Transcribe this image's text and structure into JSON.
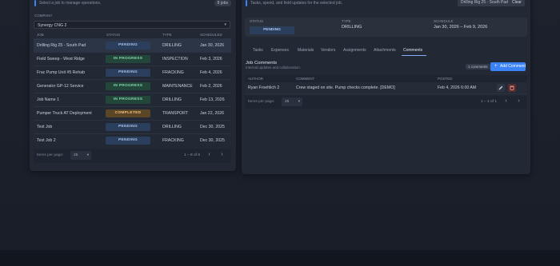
{
  "left_panel": {
    "subtitle": "Select a job to manage operations.",
    "jobs_badge": "8 jobs",
    "company_label": "COMPANY",
    "company_value": "Synergy CNG 2",
    "columns": [
      "JOB",
      "STATUS",
      "TYPE",
      "SCHEDULED"
    ],
    "rows": [
      {
        "job": "Drilling Rig 25 - South Pad",
        "status": "PENDING",
        "type": "DRILLING",
        "scheduled": "Jan 30, 2026"
      },
      {
        "job": "Field Sweep - West Ridge",
        "status": "IN PROGRESS",
        "type": "INSPECTION",
        "scheduled": "Feb 3, 2026"
      },
      {
        "job": "Frac Pump Unit #5 Rehab",
        "status": "PENDING",
        "type": "FRACKING",
        "scheduled": "Feb 4, 2026"
      },
      {
        "job": "Generator GP-12 Service",
        "status": "IN PROGRESS",
        "type": "MAINTENANCE",
        "scheduled": "Feb 2, 2026"
      },
      {
        "job": "Job Name 1",
        "status": "IN PROGRESS",
        "type": "DRILLING",
        "scheduled": "Feb 13, 2026"
      },
      {
        "job": "Pumper Truck AT Deployment",
        "status": "COMPLETED",
        "type": "TRANSPORT",
        "scheduled": "Jan 22, 2026"
      },
      {
        "job": "Test Job",
        "status": "PENDING",
        "type": "DRILLING",
        "scheduled": "Dec 30, 2025"
      },
      {
        "job": "Test Job 2",
        "status": "PENDING",
        "type": "FRACKING",
        "scheduled": "Dec 30, 2025"
      }
    ],
    "footer": {
      "items_per_page_label": "Items per page:",
      "items_per_page": "25",
      "range": "1 – 8 of 8"
    }
  },
  "right_panel": {
    "subtitle": "Tasks, spend, and field updates for the selected job.",
    "job_chip": "Drilling Rig 25 - South Pad",
    "clear_label": "Clear",
    "summary": {
      "status_label": "STATUS",
      "status_value": "PENDING",
      "type_label": "TYPE",
      "type_value": "DRILLING",
      "schedule_label": "SCHEDULE",
      "schedule_value": "Jan 30, 2026 – Feb 9, 2026"
    },
    "tabs": [
      "Tasks",
      "Expenses",
      "Materials",
      "Vendors",
      "Assignments",
      "Attachments",
      "Comments"
    ],
    "active_tab": "Comments",
    "comments": {
      "title": "Job Comments",
      "subtitle": "Internal updates and collaboration.",
      "count_badge": "1 comments",
      "add_button": "Add Comment",
      "columns": [
        "AUTHOR",
        "COMMENT",
        "POSTED"
      ],
      "rows": [
        {
          "author": "Ryan Froehlich 2",
          "comment": "Crew staged on site. Pump checks complete. [DEMO]",
          "posted": "Feb 4, 2026 6:00 AM"
        }
      ],
      "footer": {
        "items_per_page_label": "Items per page:",
        "items_per_page": "25",
        "range": "1 – 1 of 1"
      }
    }
  },
  "colors": {
    "accent": "#3b82f6",
    "pending": "#2b3e5c",
    "in_progress": "#23463a",
    "completed": "#5a4527",
    "delete": "#5a2a2e"
  },
  "icons": {
    "add": "plus-icon",
    "edit": "pencil-icon",
    "delete": "trash-icon",
    "prev": "chevron-left-icon",
    "next": "chevron-right-icon",
    "dropdown": "chevron-down-icon"
  }
}
